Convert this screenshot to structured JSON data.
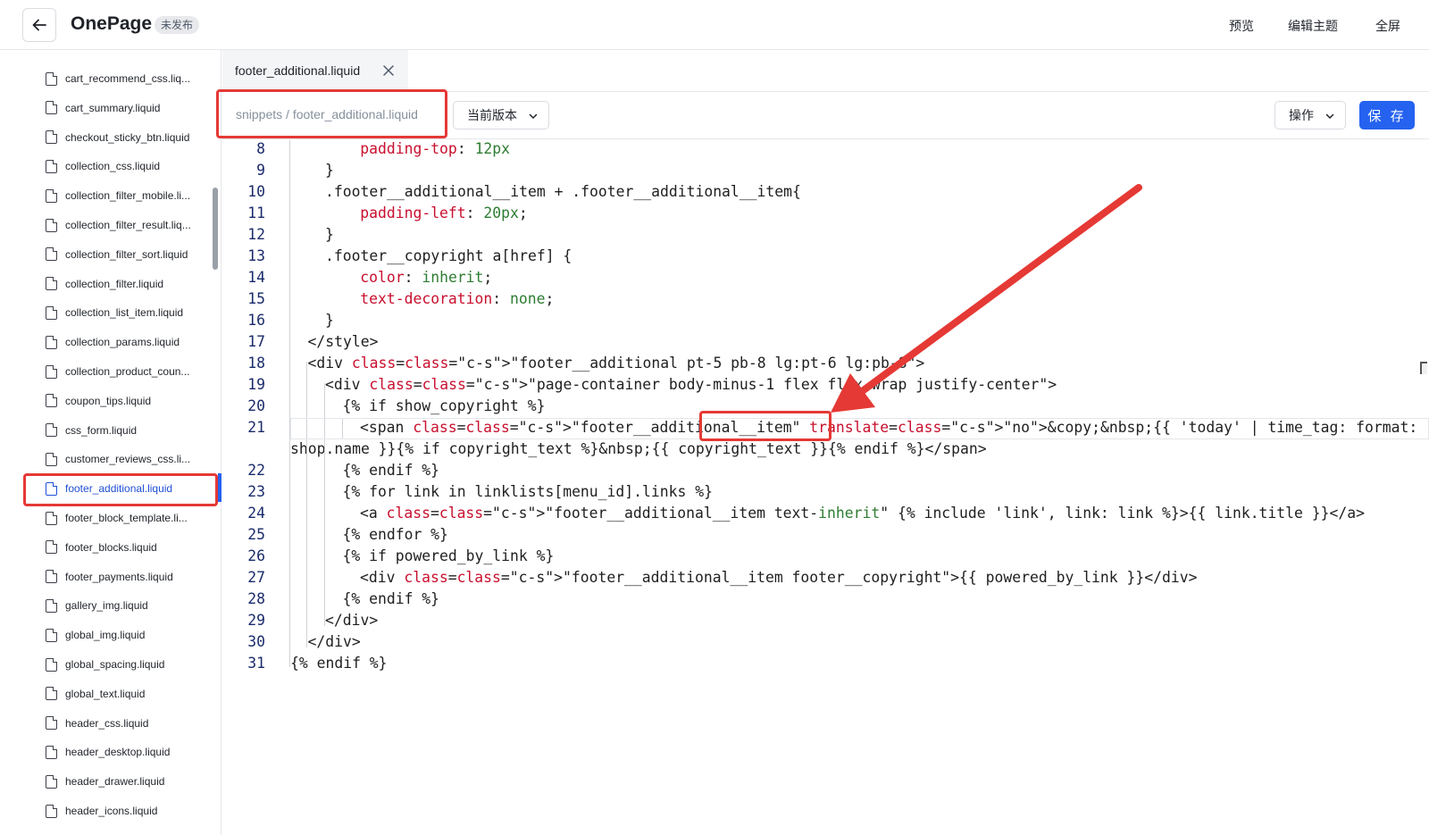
{
  "header": {
    "title": "OnePage",
    "status": "未发布",
    "actions": [
      "预览",
      "编辑主题",
      "全屏"
    ]
  },
  "sidebar": {
    "files": [
      "cart_recommend_css.liq...",
      "cart_summary.liquid",
      "checkout_sticky_btn.liquid",
      "collection_css.liquid",
      "collection_filter_mobile.li...",
      "collection_filter_result.liq...",
      "collection_filter_sort.liquid",
      "collection_filter.liquid",
      "collection_list_item.liquid",
      "collection_params.liquid",
      "collection_product_coun...",
      "coupon_tips.liquid",
      "css_form.liquid",
      "customer_reviews_css.li...",
      "footer_additional.liquid",
      "footer_block_template.li...",
      "footer_blocks.liquid",
      "footer_payments.liquid",
      "gallery_img.liquid",
      "global_img.liquid",
      "global_spacing.liquid",
      "global_text.liquid",
      "header_css.liquid",
      "header_desktop.liquid",
      "header_drawer.liquid",
      "header_icons.liquid"
    ],
    "active_index": 14
  },
  "editor": {
    "tab_label": "footer_additional.liquid",
    "path": "snippets / footer_additional.liquid",
    "version_label": "当前版本",
    "ops_label": "操作",
    "save_label": "保 存"
  },
  "code": {
    "lines": [
      {
        "n": "8",
        "t": "  padding-top: 12px"
      },
      {
        "n": "9",
        "t": "}"
      },
      {
        "n": "10",
        "t": ".footer__additional__item + .footer__additional__item{"
      },
      {
        "n": "11",
        "t": "  padding-left: 20px;"
      },
      {
        "n": "12",
        "t": "}"
      },
      {
        "n": "13",
        "t": ".footer__copyright a[href] {"
      },
      {
        "n": "14",
        "t": "  color: inherit;"
      },
      {
        "n": "15",
        "t": "  text-decoration: none;"
      },
      {
        "n": "16",
        "t": "}"
      },
      {
        "n": "17",
        "t": "</style>"
      },
      {
        "n": "18",
        "t": "<div class=\"footer__additional pt-5 pb-8 lg:pt-6 lg:pb-8\">"
      },
      {
        "n": "19",
        "t": "<div class=\"page-container body-minus-1 flex flex-wrap justify-center\">"
      },
      {
        "n": "20",
        "t": "{% if show_copyright %}"
      },
      {
        "n": "21",
        "t": "<span class=\"footer__additional__item\" translate=\"no\">&copy;&nbsp;{{ 'today' | time_tag: format: 'year' }}&nbsp;{{"
      },
      {
        "n": "",
        "t": "shop.name }}{% if copyright_text %}&nbsp;{{ copyright_text }}{% endif %}</span>"
      },
      {
        "n": "22",
        "t": "{% endif %}"
      },
      {
        "n": "23",
        "t": "{% for link in linklists[menu_id].links %}"
      },
      {
        "n": "24",
        "t": "<a class=\"footer__additional__item text-inherit\" {% include 'link', link: link %}>{{ link.title }}</a>"
      },
      {
        "n": "25",
        "t": "{% endfor %}"
      },
      {
        "n": "26",
        "t": "{% if powered_by_link %}"
      },
      {
        "n": "27",
        "t": "<div class=\"footer__additional__item footer__copyright\">{{ powered_by_link }}</div>"
      },
      {
        "n": "28",
        "t": "{% endif %}"
      },
      {
        "n": "29",
        "t": "</div>"
      },
      {
        "n": "30",
        "t": "</div>"
      },
      {
        "n": "31",
        "t": "{% endif %}"
      }
    ]
  }
}
